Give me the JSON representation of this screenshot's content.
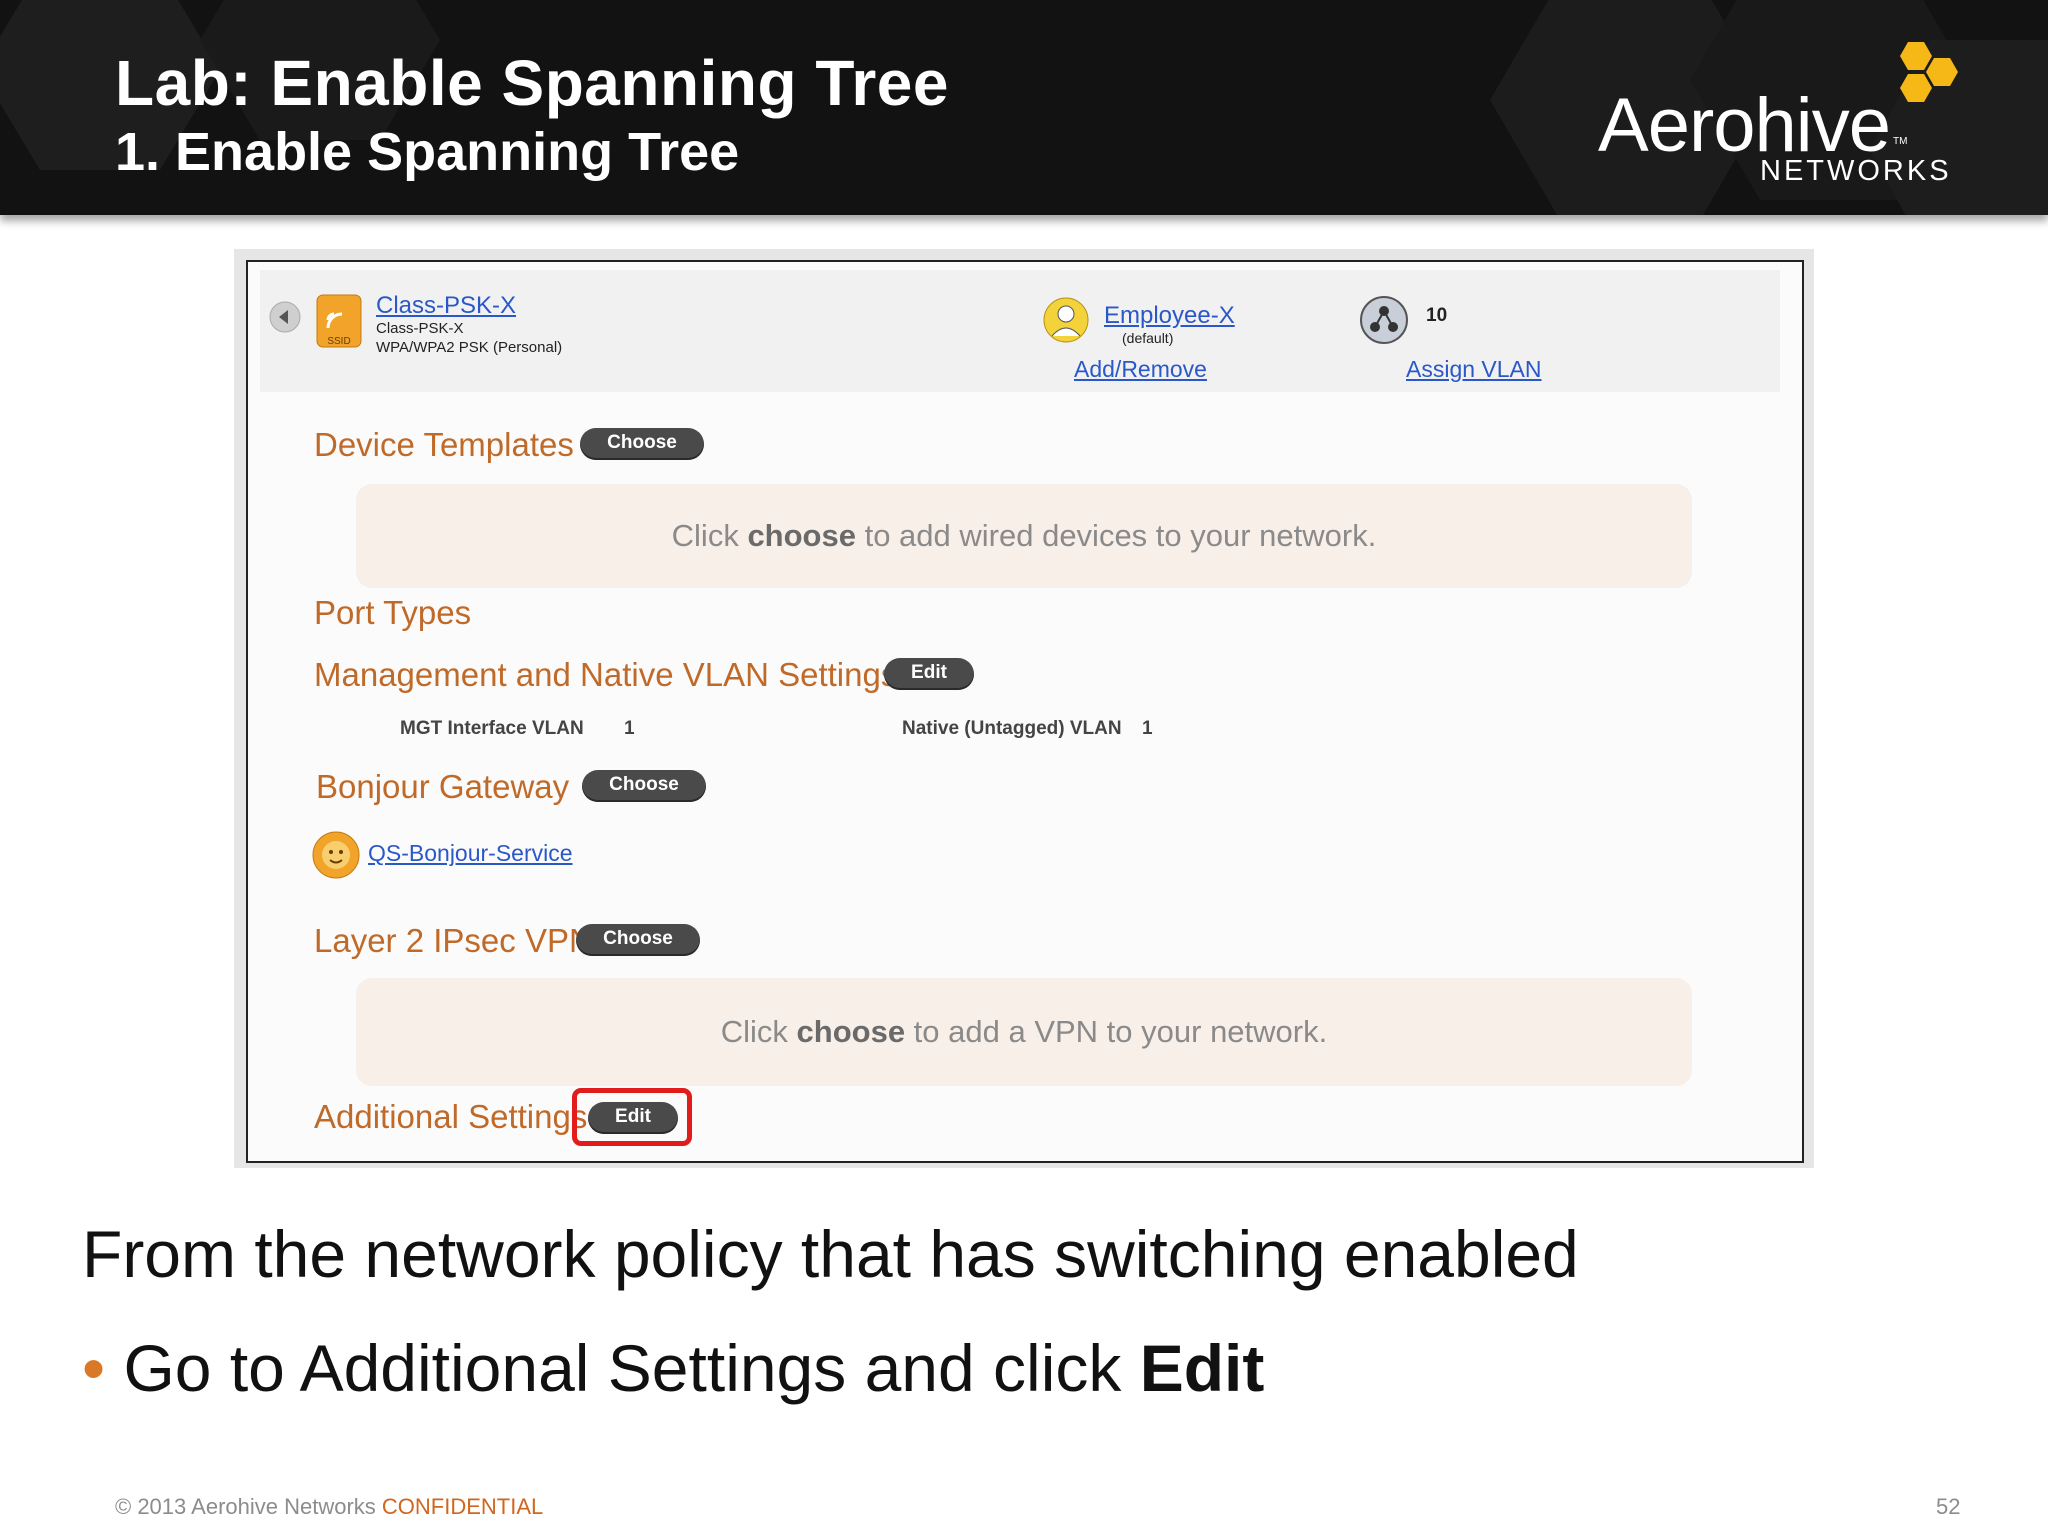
{
  "slide": {
    "title": "Lab: Enable Spanning Tree",
    "subtitle": "1. Enable Spanning Tree",
    "logo_word": "Aerohive",
    "logo_tm": "TM",
    "logo_sub": "NETWORKS"
  },
  "screenshot": {
    "ssid_name": "Class-PSK-X",
    "ssid_sub": "Class-PSK-X",
    "ssid_security": "WPA/WPA2 PSK (Personal)",
    "ssid_badge": "SSID",
    "user_profile": "Employee-X",
    "user_profile_sub": "(default)",
    "add_remove": "Add/Remove",
    "vlan_value": "10",
    "assign_vlan": "Assign VLAN",
    "device_templates": "Device Templates",
    "choose": "Choose",
    "edit": "Edit",
    "device_info_pre": "Click ",
    "device_info_bold": "choose",
    "device_info_post": " to add wired devices to your network.",
    "port_types": "Port Types",
    "mgmt_vlan_settings": "Management and Native VLAN Settings",
    "mgt_interface_vlan_label": "MGT Interface VLAN",
    "mgt_interface_vlan_value": "1",
    "native_vlan_label": "Native (Untagged) VLAN",
    "native_vlan_value": "1",
    "bonjour_gateway": "Bonjour Gateway",
    "bonjour_service": "QS-Bonjour-Service",
    "l2_ipsec_vpn": "Layer 2 IPsec VPN",
    "vpn_info_pre": "Click ",
    "vpn_info_bold": "choose",
    "vpn_info_post": " to add a VPN to your network.",
    "additional_settings": "Additional Settings"
  },
  "body": {
    "line1": "From the network policy that has switching enabled",
    "bullet": "•",
    "line2_pre": "Go to Additional Settings and click ",
    "line2_bold": "Edit"
  },
  "footer": {
    "copyright": "© 2013 Aerohive Networks ",
    "confidential": "CONFIDENTIAL",
    "page": "52"
  },
  "colors": {
    "header_bg": "#121212",
    "accent_orange": "#d97826",
    "logo_yellow": "#f6b817",
    "label_orange": "#c06a2a",
    "highlight_red": "#e21b1b",
    "link_blue": "#2a58c8"
  }
}
